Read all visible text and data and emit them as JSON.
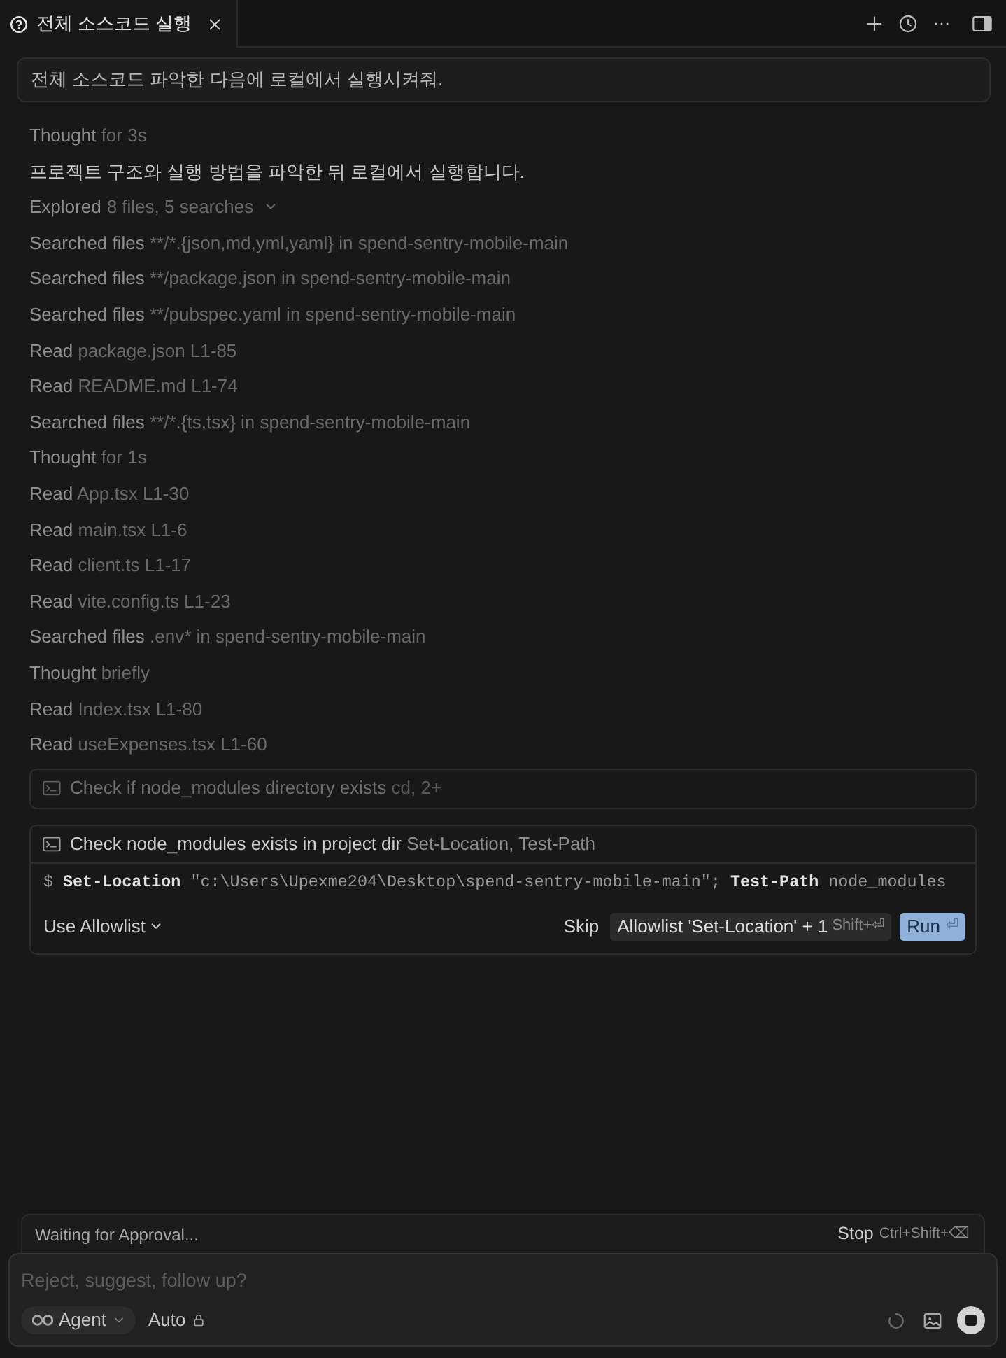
{
  "tabs": [
    {
      "title": "전체 소스코드 실행",
      "selected": true
    }
  ],
  "user_message": "전체 소스코드 파악한 다음에 로컬에서 실행시켜줘.",
  "thought": {
    "label": "Thought",
    "detail": "for 3s"
  },
  "reply": "프로젝트 구조와 실행 방법을 파악한 뒤 로컬에서 실행합니다.",
  "explored": {
    "label": "Explored",
    "detail": "8 files, 5 searches",
    "items": [
      {
        "action": "Searched files",
        "detail": "**/*.{json,md,yml,yaml} in spend-sentry-mobile-main"
      },
      {
        "action": "Searched files",
        "detail": "**/package.json in spend-sentry-mobile-main"
      },
      {
        "action": "Searched files",
        "detail": "**/pubspec.yaml in spend-sentry-mobile-main"
      },
      {
        "action": "Read",
        "detail": "package.json L1-85"
      },
      {
        "action": "Read",
        "detail": "README.md L1-74"
      },
      {
        "action": "Searched files",
        "detail": "**/*.{ts,tsx} in spend-sentry-mobile-main"
      },
      {
        "action": "Thought",
        "detail": "for 1s"
      },
      {
        "action": "Read",
        "detail": "App.tsx L1-30"
      },
      {
        "action": "Read",
        "detail": "main.tsx L1-6"
      },
      {
        "action": "Read",
        "detail": "client.ts L1-17"
      },
      {
        "action": "Read",
        "detail": "vite.config.ts L1-23"
      },
      {
        "action": "Searched files",
        "detail": ".env* in spend-sentry-mobile-main"
      },
      {
        "action": "Thought",
        "detail": "briefly"
      },
      {
        "action": "Read",
        "detail": "Index.tsx L1-80"
      },
      {
        "action": "Read",
        "detail": "useExpenses.tsx L1-60"
      }
    ]
  },
  "commands": [
    {
      "title": "Check if node_modules directory exists",
      "detail": "cd, 2+",
      "expanded": false
    },
    {
      "title": "Check node_modules exists in project dir",
      "detail": "Set-Location, Test-Path",
      "expanded": true,
      "command": [
        {
          "kind": "prompt",
          "text": "$"
        },
        {
          "kind": "command",
          "text": "Set-Location"
        },
        {
          "kind": "argument",
          "text": "\"c:\\Users\\Upexme204\\Desktop\\spend-sentry-mobile-main\";"
        },
        {
          "kind": "command",
          "text": "Test-Path"
        },
        {
          "kind": "argument",
          "text": "node_modules"
        }
      ],
      "allowlist_menu": "Use Allowlist",
      "actions": [
        {
          "kind": "plain",
          "label": "Skip"
        },
        {
          "kind": "secondary",
          "label": "Allowlist 'Set-Location' + 1",
          "shortcut": "Shift+⏎"
        },
        {
          "kind": "primary",
          "label": "Run",
          "shortcut": "⏎"
        }
      ]
    }
  ],
  "status_bar": {
    "text": "Waiting for Approval...",
    "stop_label": "Stop",
    "stop_shortcut": "Ctrl+Shift+⌫"
  },
  "composer": {
    "placeholder": "Reject, suggest, follow up?",
    "mode": "Agent",
    "model": "Auto"
  }
}
